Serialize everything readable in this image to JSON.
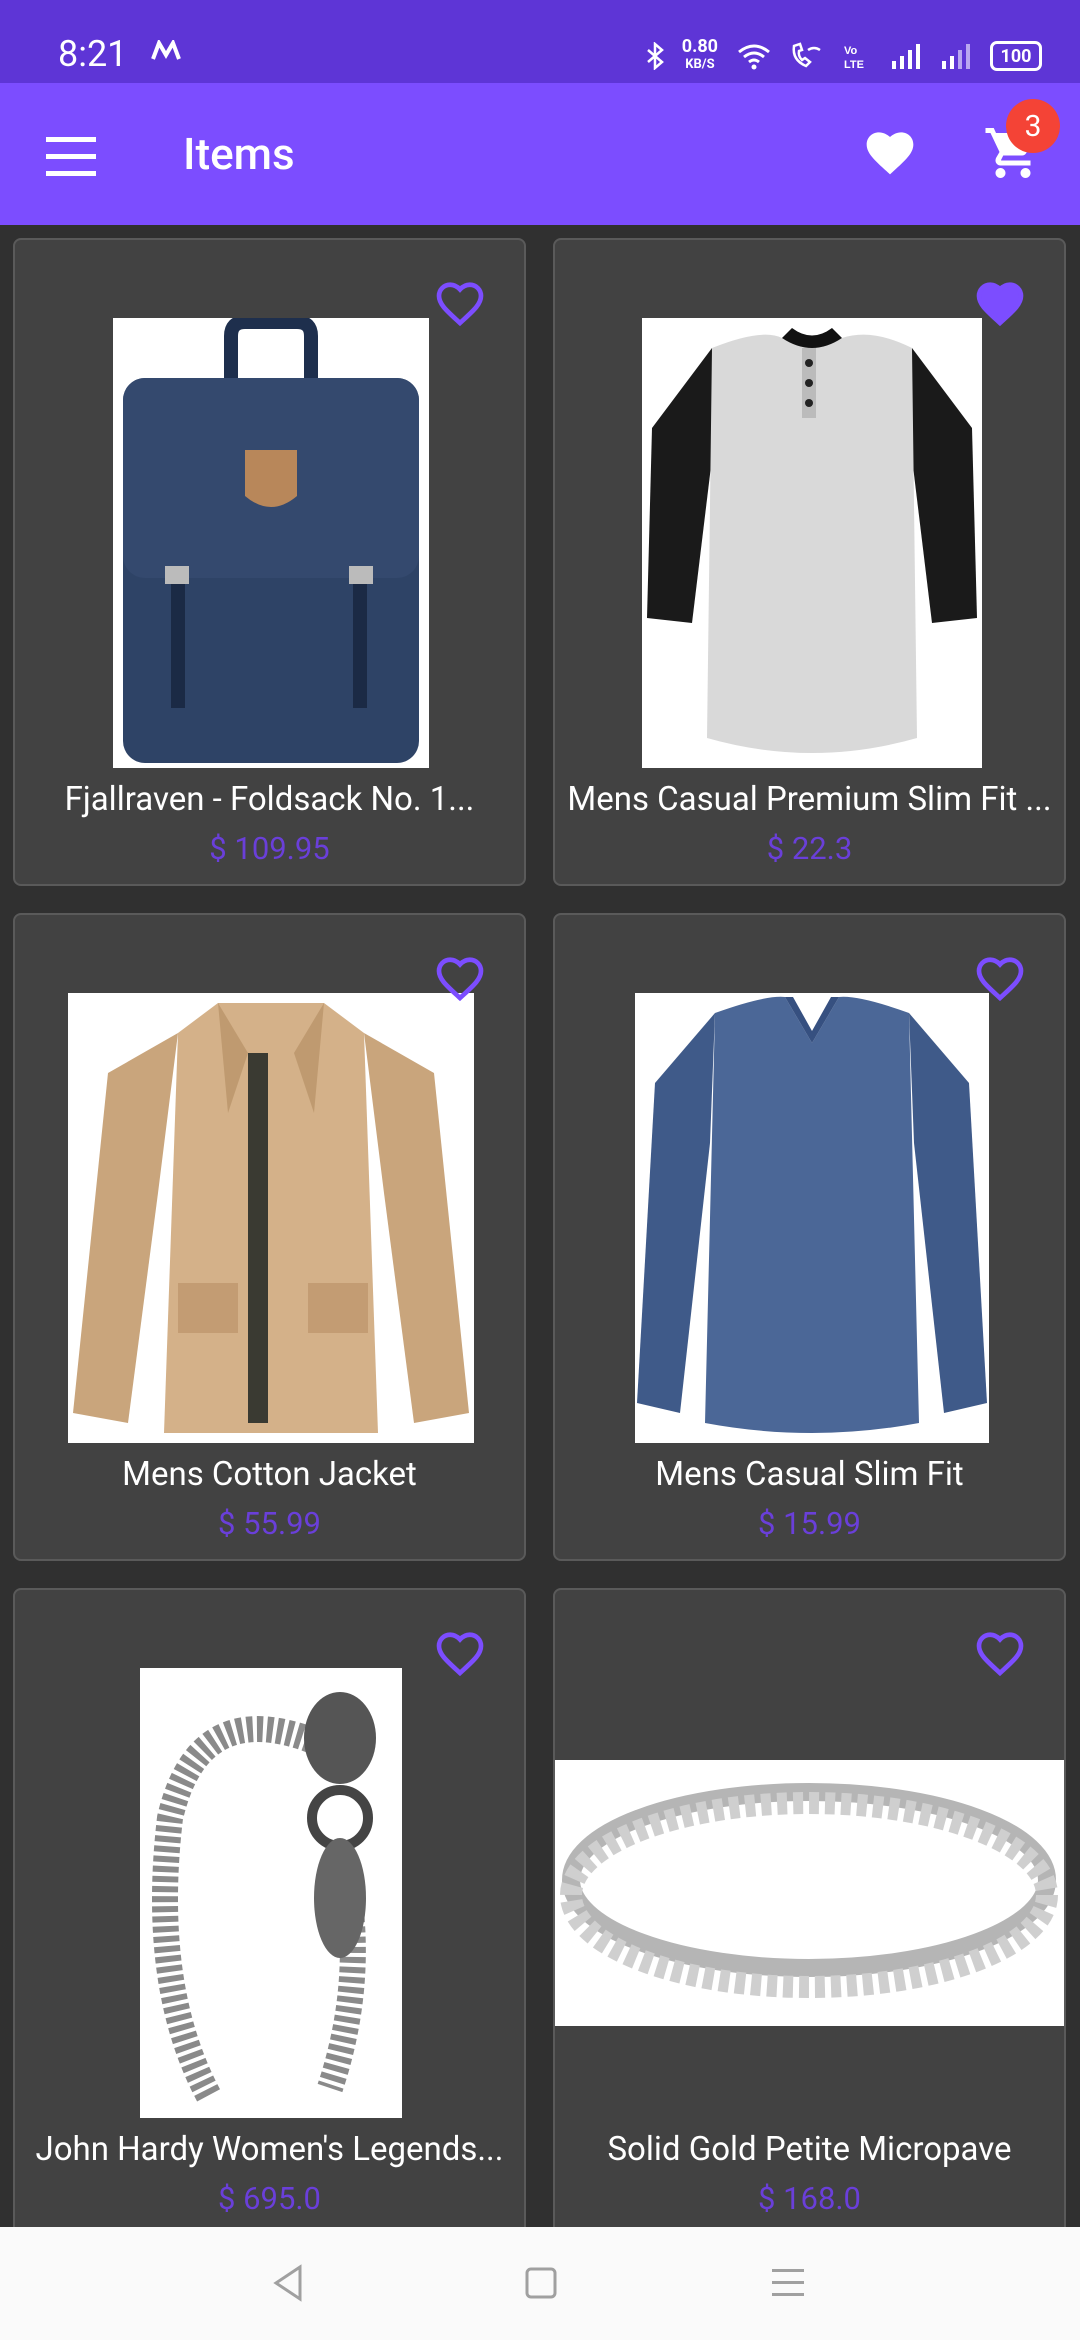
{
  "status": {
    "time": "8:21",
    "net_speed_value": "0.80",
    "net_speed_unit": "KB/S",
    "battery": "100"
  },
  "appbar": {
    "title": "Items",
    "cart_count": "3"
  },
  "items": [
    {
      "name": "Fjallraven - Foldsack No. 1...",
      "price": "$ 109.95",
      "favorite": false,
      "icon": "backpack-image"
    },
    {
      "name": "Mens Casual Premium Slim Fit ...",
      "price": "$ 22.3",
      "favorite": true,
      "icon": "raglan-tshirt-image"
    },
    {
      "name": "Mens Cotton Jacket",
      "price": "$ 55.99",
      "favorite": false,
      "icon": "jacket-image"
    },
    {
      "name": "Mens Casual Slim Fit",
      "price": "$ 15.99",
      "favorite": false,
      "icon": "longsleeve-shirt-image"
    },
    {
      "name": "John Hardy Women's Legends...",
      "price": "$ 695.0",
      "favorite": false,
      "icon": "bracelet-image"
    },
    {
      "name": "Solid Gold Petite Micropave",
      "price": "$ 168.0",
      "favorite": false,
      "icon": "ring-image"
    }
  ],
  "colors": {
    "accent": "#7c4dff",
    "status_bar": "#5e35d6",
    "card": "#424242",
    "badge": "#f44336"
  }
}
